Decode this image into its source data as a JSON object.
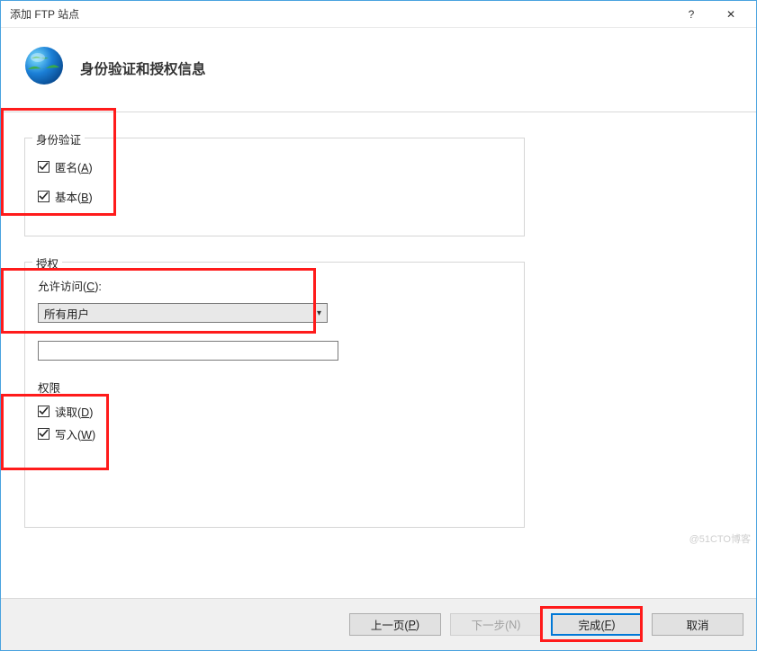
{
  "window": {
    "title": "添加 FTP 站点",
    "help": "?",
    "close": "✕"
  },
  "header": {
    "title": "身份验证和授权信息"
  },
  "auth": {
    "legend": "身份验证",
    "anonymous_label": "匿名(",
    "anonymous_key": "A",
    "anonymous_suffix": ")",
    "basic_label": "基本(",
    "basic_key": "B",
    "basic_suffix": ")"
  },
  "authz": {
    "legend": "授权",
    "access_label": "允许访问(",
    "access_key": "C",
    "access_suffix": "):",
    "dropdown_value": "所有用户"
  },
  "perm": {
    "legend": "权限",
    "read_label": "读取(",
    "read_key": "D",
    "read_suffix": ")",
    "write_label": "写入(",
    "write_key": "W",
    "write_suffix": ")"
  },
  "footer": {
    "prev": "上一页(",
    "prev_key": "P",
    "prev_suffix": ")",
    "next": "下一步(",
    "next_key": "N",
    "next_suffix": ")",
    "finish": "完成(",
    "finish_key": "F",
    "finish_suffix": ")",
    "cancel": "取消"
  },
  "watermark": "@51CTO博客"
}
